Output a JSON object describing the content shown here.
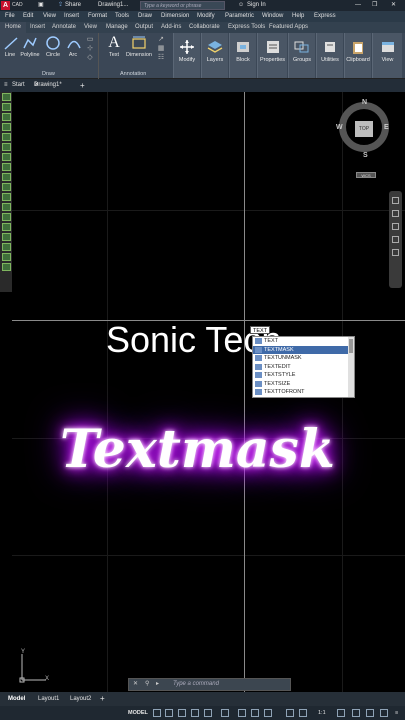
{
  "titlebar": {
    "logo": "A",
    "cad_label": "CAD",
    "share_label": "Share",
    "doc_title": "Drawing1...",
    "search_placeholder": "Type a keyword or phrase",
    "sign_in": "Sign In"
  },
  "menubar": [
    "File",
    "Edit",
    "View",
    "Insert",
    "Format",
    "Tools",
    "Draw",
    "Dimension",
    "Modify",
    "Parametric",
    "Window",
    "Help",
    "Express"
  ],
  "ribbon_tabs": [
    "Home",
    "Insert",
    "Annotate",
    "View",
    "Manage",
    "Output",
    "Add-ins",
    "Collaborate",
    "Express Tools",
    "Featured Apps"
  ],
  "ribbon": {
    "draw_tools": [
      "Line",
      "Polyline",
      "Circle",
      "Arc"
    ],
    "annotation_tools": [
      "Text",
      "Dimension"
    ],
    "big_buttons": [
      "Modify",
      "Layers",
      "Block",
      "Properties",
      "Groups",
      "Utilities",
      "Clipboard",
      "View"
    ],
    "panel_draw": "Draw",
    "panel_annotation": "Annotation"
  },
  "file_tabs": {
    "start": "Start",
    "drawing": "Drawing1*",
    "new": "+"
  },
  "canvas": {
    "text1": "Sonic Tech",
    "text2": "Textmask",
    "typed_command": "TEXT"
  },
  "autocomplete": [
    "TEXT",
    "TEXTMASK",
    "TEXTUNMASK",
    "TEXTEDIT",
    "TEXTSTYLE",
    "TEXTSIZE",
    "TEXTTOFRONT"
  ],
  "viewcube": {
    "face": "TOP",
    "n": "N",
    "s": "S",
    "e": "E",
    "w": "W",
    "wcs": "WCS"
  },
  "ucs": {
    "x": "X",
    "y": "Y"
  },
  "command_line": {
    "placeholder": "Type a command"
  },
  "layout_tabs": [
    "Model",
    "Layout1",
    "Layout2",
    "+"
  ],
  "statusbar": {
    "model": "MODEL",
    "scale": "1:1"
  },
  "colors": {
    "accent": "#3f6aa8",
    "glow": "#c000ff",
    "logo_red": "#c8102e"
  }
}
